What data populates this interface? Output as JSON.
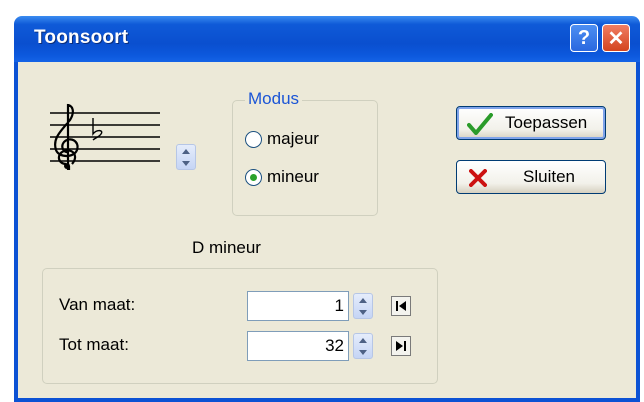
{
  "window": {
    "title": "Toonsoort",
    "help_glyph": "?",
    "close_glyph": "✕"
  },
  "key": {
    "display": "D mineur"
  },
  "modus": {
    "label": "Modus",
    "options": [
      "majeur",
      "mineur"
    ],
    "selected": "mineur"
  },
  "buttons": {
    "apply": "Toepassen",
    "close": "Sluiten"
  },
  "range": {
    "from_label": "Van maat:",
    "from_value": "1",
    "to_label": "Tot maat:",
    "to_value": "32"
  },
  "colors": {
    "title_bar": "#0a4fcf",
    "accent_label": "#1b55d6",
    "radio_selected": "#2ba22b",
    "check": "#2a9b2a",
    "cross": "#cc1111"
  },
  "icons": {
    "treble_clef": "treble-clef-icon",
    "flat": "flat-icon",
    "check": "check-icon",
    "cross": "cross-icon",
    "first": "go-first-icon",
    "last": "go-last-icon"
  }
}
